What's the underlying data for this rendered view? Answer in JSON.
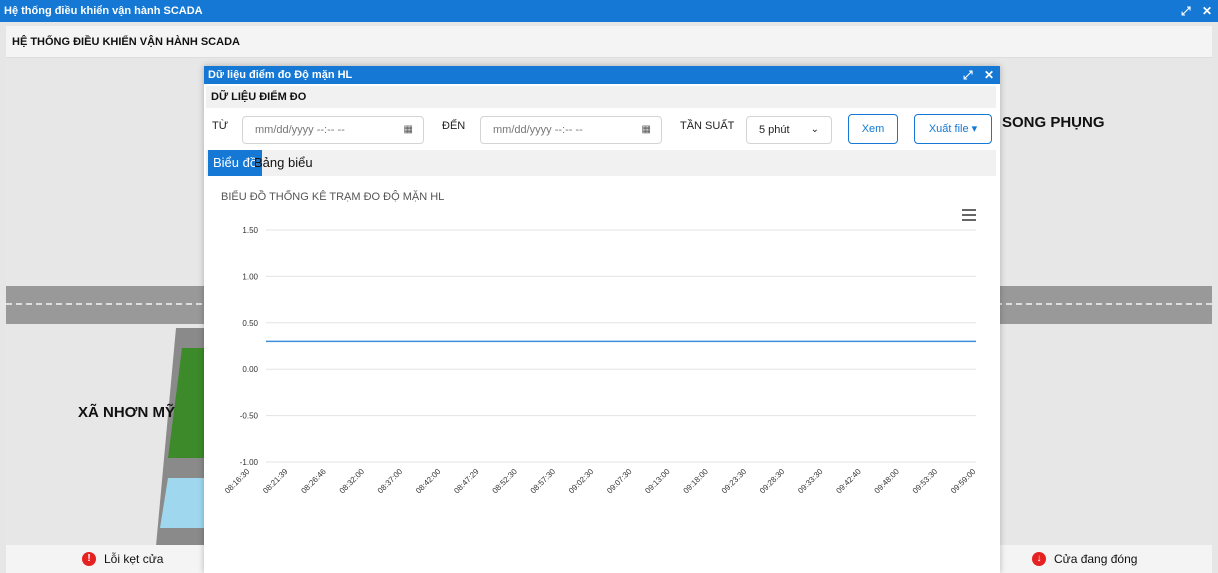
{
  "app": {
    "window_title": "Hệ thống điều khiển vận hành SCADA",
    "header_title": "HỆ THỐNG ĐIỀU KHIỂN VẬN HÀNH SCADA",
    "maximize_glyph": "⤢",
    "close_glyph": "✕"
  },
  "map": {
    "label_left": "XÃ NHƠN MỸ",
    "label_right": "SONG PHỤNG"
  },
  "statusbar": {
    "left_label": "Lỗi kẹt cửa",
    "left_icon": "!",
    "right_label": "Cửa đang đóng",
    "right_icon": "↓"
  },
  "modal": {
    "title": "Dữ liệu điểm đo Độ mặn HL",
    "section_title": "DỮ LIỆU ĐIỂM ĐO",
    "from_label": "TỪ",
    "from_placeholder": "mm/dd/yyyy --:-- --",
    "to_label": "ĐẾN",
    "to_placeholder": "mm/dd/yyyy --:-- --",
    "freq_label": "TẦN SUẤT",
    "freq_value": "5 phút",
    "view_button": "Xem",
    "export_button": "Xuất file ▾",
    "tabs": [
      {
        "label": "Biểu đồ",
        "active": true
      },
      {
        "label": "Bảng biểu",
        "active": false
      }
    ]
  },
  "chart_data": {
    "type": "line",
    "title": "BIỂU ĐỒ THỐNG KÊ TRẠM ĐO ĐỘ MẶN HL",
    "xlabel": "",
    "ylabel": "",
    "ylim": [
      -1.0,
      1.5
    ],
    "yticks": [
      "1.50",
      "1.00",
      "0.50",
      "0.00",
      "-0.50",
      "-1.00"
    ],
    "ytick_values": [
      1.5,
      1.0,
      0.5,
      0.0,
      -0.5,
      -1.0
    ],
    "categories": [
      "08:16:30",
      "08:21:39",
      "08:26:46",
      "08:32:00",
      "08:37:00",
      "08:42:00",
      "08:47:29",
      "08:52:30",
      "08:57:30",
      "09:02:30",
      "09:07:30",
      "09:13:00",
      "09:18:00",
      "09:23:30",
      "09:28:30",
      "09:33:30",
      "09:42:40",
      "09:48:00",
      "09:53:30",
      "09:59:00"
    ],
    "series": [
      {
        "values": [
          0.3,
          0.3,
          0.3,
          0.3,
          0.3,
          0.3,
          0.3,
          0.3,
          0.3,
          0.3,
          0.3,
          0.3,
          0.3,
          0.3,
          0.3,
          0.3,
          0.3,
          0.3,
          0.3,
          0.3
        ]
      }
    ],
    "grid": true,
    "legend": "none",
    "line_color": "#3b8fdb"
  }
}
